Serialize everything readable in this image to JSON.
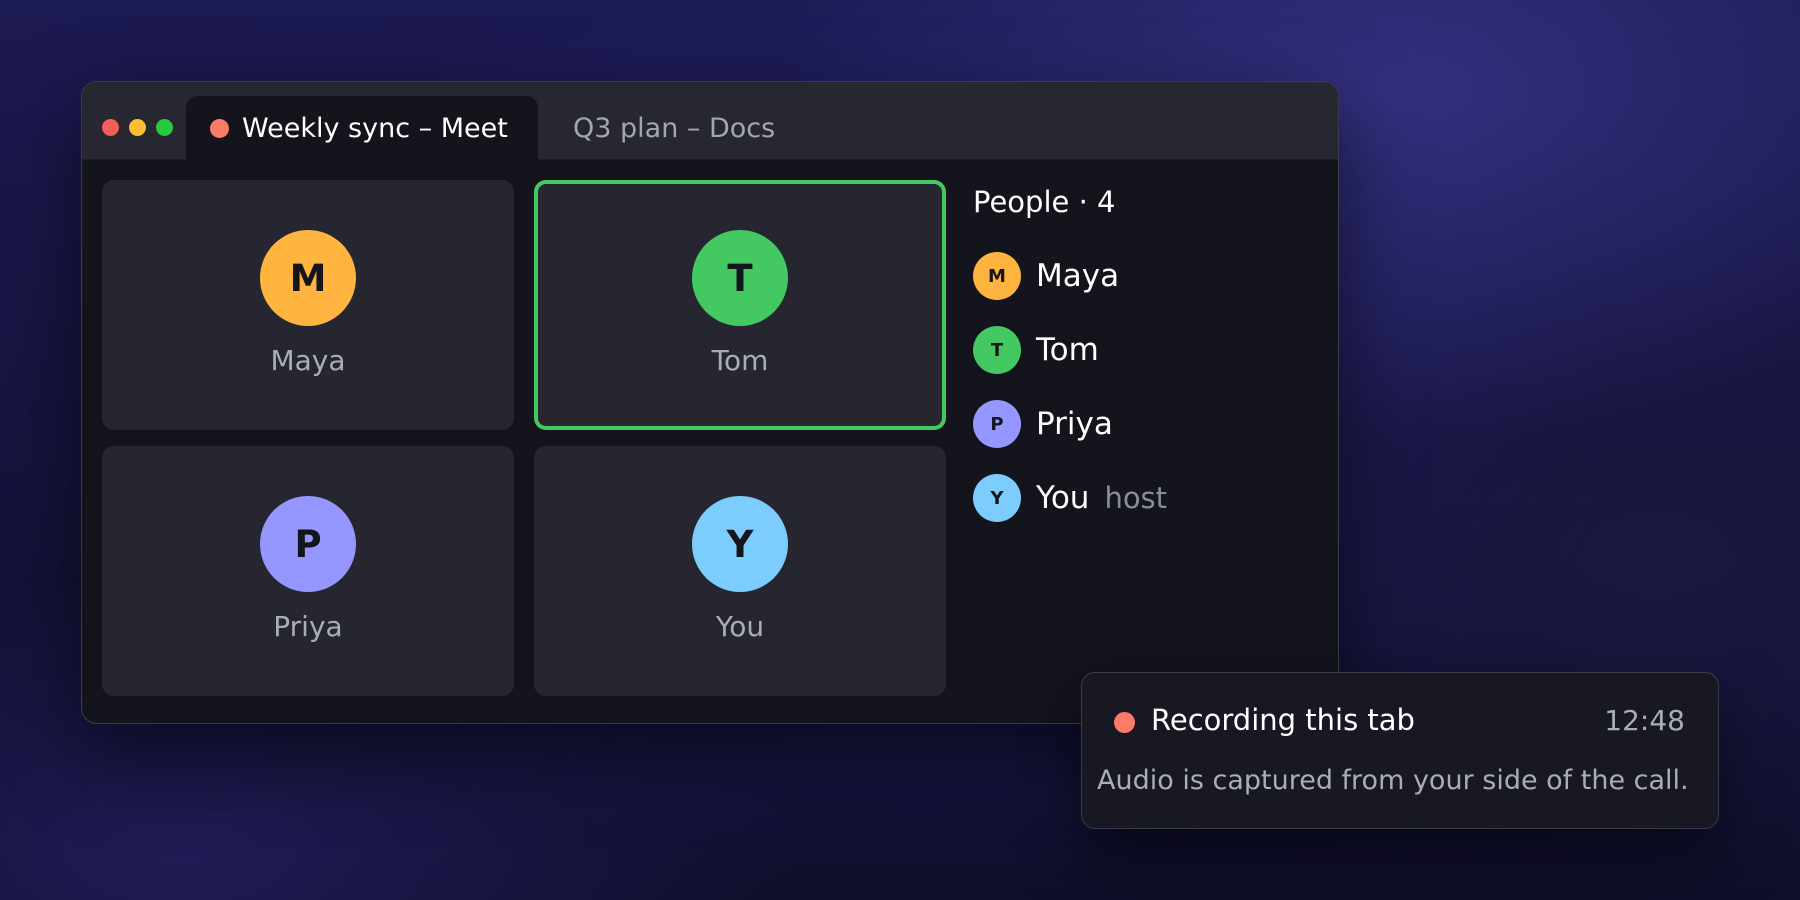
{
  "browser": {
    "tabs": [
      {
        "label": "Weekly sync – Meet",
        "active": true,
        "recording": true
      },
      {
        "label": "Q3 plan – Docs",
        "active": false
      }
    ]
  },
  "meeting": {
    "speaking": "Tom",
    "tiles": [
      {
        "initial": "M",
        "name": "Maya",
        "color": "#ffb43f"
      },
      {
        "initial": "T",
        "name": "Tom",
        "color": "#44c862"
      },
      {
        "initial": "P",
        "name": "Priya",
        "color": "#9596ff"
      },
      {
        "initial": "Y",
        "name": "You",
        "color": "#7ccdfd"
      }
    ]
  },
  "people": {
    "title": "People · 4",
    "list": [
      {
        "initial": "M",
        "name": "Maya",
        "role": ""
      },
      {
        "initial": "T",
        "name": "Tom",
        "role": ""
      },
      {
        "initial": "P",
        "name": "Priya",
        "role": ""
      },
      {
        "initial": "Y",
        "name": "You",
        "role": "host"
      }
    ]
  },
  "toast": {
    "title": "Recording this tab",
    "time": "12:48",
    "body": "Audio is captured from your side of the call.",
    "accent": "#fa7b68"
  },
  "icons": {
    "window_controls": [
      "close-icon",
      "minimize-icon",
      "maximize-icon"
    ],
    "recording": "recording-dot-icon"
  }
}
